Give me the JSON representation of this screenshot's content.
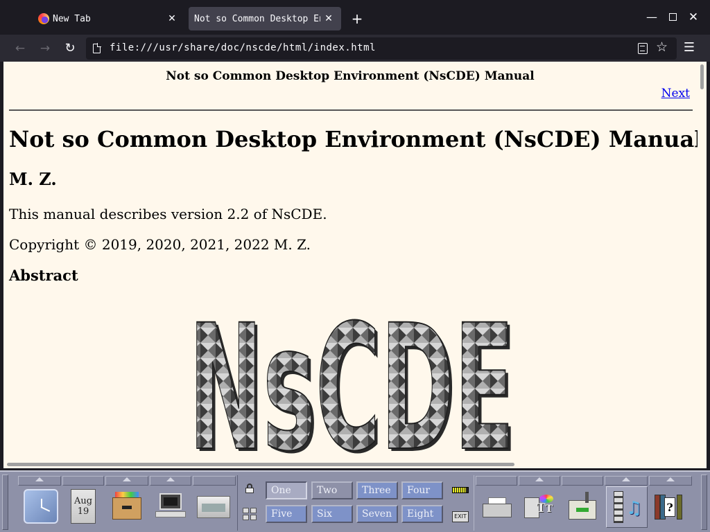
{
  "browser": {
    "tabs": [
      {
        "label": "New Tab"
      },
      {
        "label": "Not so Common Desktop Environment (NsCDE) Manual"
      }
    ],
    "url": "file:///usr/share/doc/nscde/html/index.html"
  },
  "page": {
    "header_title": "Not so Common Desktop Environment (NsCDE) Manual",
    "next_link": "Next",
    "title": "Not so Common Desktop Environment (NsCDE) Manual",
    "author": "M. Z.",
    "version_line": "This manual describes version 2.2 of NsCDE.",
    "copyright": "Copyright © 2019, 2020, 2021, 2022 M. Z.",
    "abstract_heading": "Abstract",
    "logo_text": "NsCDE"
  },
  "panel": {
    "calendar": {
      "month": "Aug",
      "day": "19"
    },
    "workspaces": [
      {
        "label": "One",
        "active": true
      },
      {
        "label": "Two"
      },
      {
        "label": "Three"
      },
      {
        "label": "Four"
      },
      {
        "label": "Five"
      },
      {
        "label": "Six"
      },
      {
        "label": "Seven"
      },
      {
        "label": "Eight"
      }
    ],
    "exit_label": "EXIT"
  },
  "colors": {
    "page_background": "#fff8ec",
    "link": "#0000ee",
    "panel": "#8e91a8",
    "browser_chrome": "#1c1b22",
    "active_tab": "#42414d"
  }
}
